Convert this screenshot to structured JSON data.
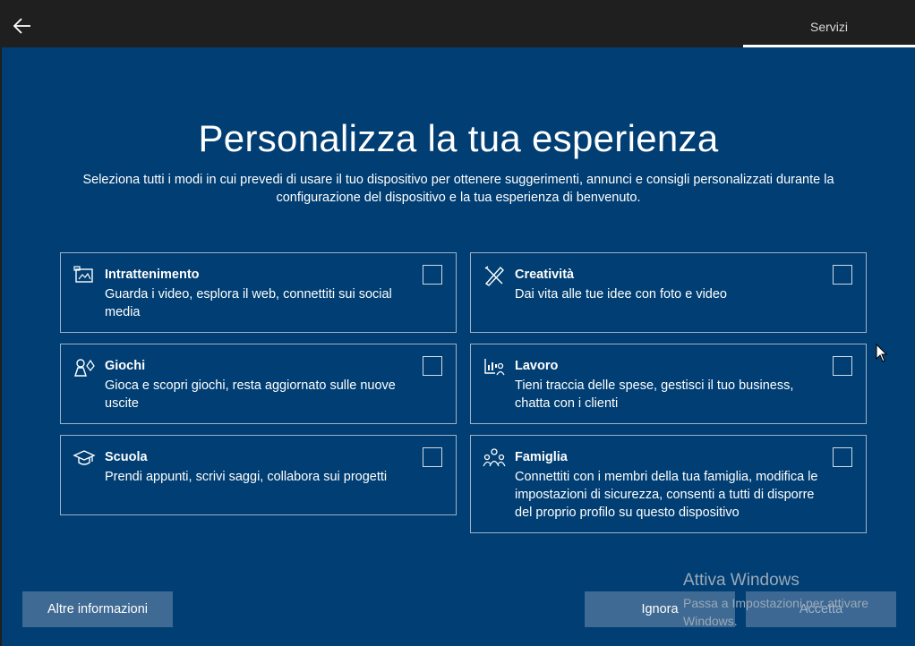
{
  "topbar": {
    "tab_label": "Servizi"
  },
  "page": {
    "title": "Personalizza la tua esperienza",
    "subtitle": "Seleziona tutti i modi in cui prevedi di usare il tuo dispositivo per ottenere suggerimenti, annunci e consigli personalizzati durante la configurazione del dispositivo e la tua esperienza di benvenuto."
  },
  "options": [
    {
      "title": "Intrattenimento",
      "desc": "Guarda i video, esplora il web, connettiti sui social media",
      "icon": "entertainment-icon",
      "checked": false
    },
    {
      "title": "Creatività",
      "desc": "Dai vita alle tue idee con foto e video",
      "icon": "creativity-icon",
      "checked": false
    },
    {
      "title": "Giochi",
      "desc": "Gioca e scopri giochi, resta aggiornato sulle nuove uscite",
      "icon": "gaming-icon",
      "checked": false
    },
    {
      "title": "Lavoro",
      "desc": "Tieni traccia delle spese, gestisci il tuo business, chatta con i clienti",
      "icon": "business-icon",
      "checked": false
    },
    {
      "title": "Scuola",
      "desc": "Prendi appunti, scrivi saggi, collabora sui progetti",
      "icon": "school-icon",
      "checked": false
    },
    {
      "title": "Famiglia",
      "desc": "Connettiti con i membri della tua famiglia, modifica le impostazioni di sicurezza, consenti a tutti di disporre del proprio profilo su questo dispositivo",
      "icon": "family-icon",
      "checked": false
    }
  ],
  "buttons": {
    "more_info": "Altre informazioni",
    "skip": "Ignora",
    "accept": "Accetta"
  },
  "watermark": {
    "line1": "Attiva Windows",
    "line2": "Passa a Impostazioni per attivare Windows."
  },
  "colors": {
    "background": "#003e73",
    "topbar": "#1f1f1f",
    "button": "#3f6a93"
  }
}
